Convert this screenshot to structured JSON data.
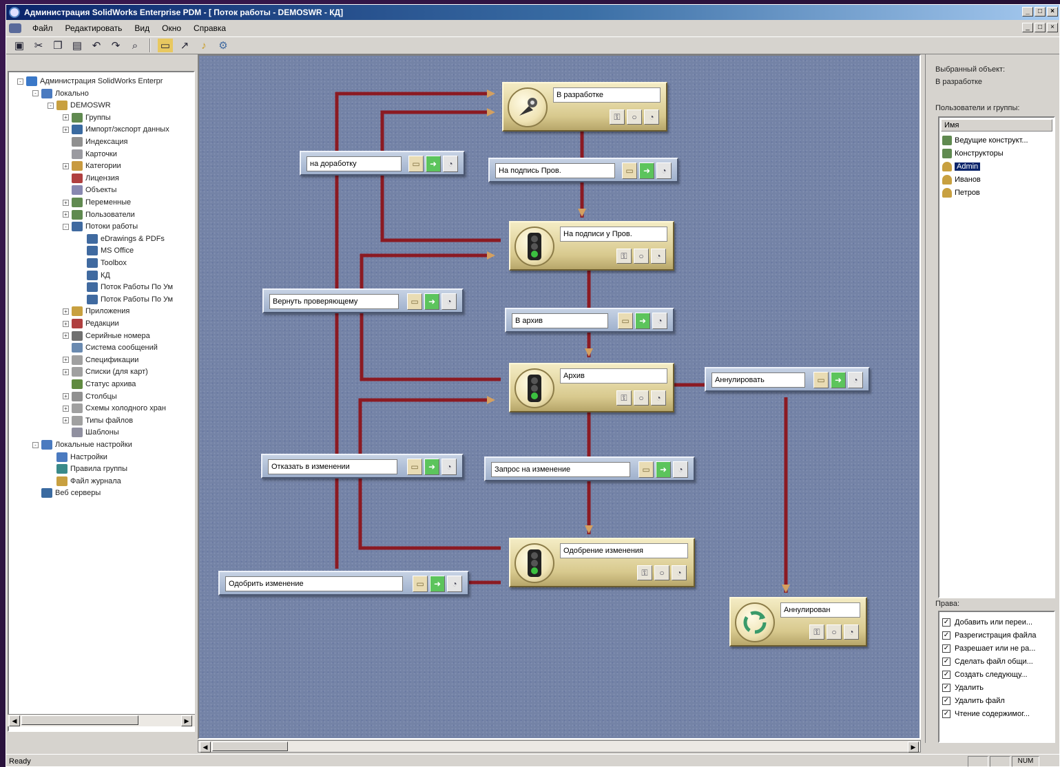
{
  "window": {
    "title": "Администрация SolidWorks Enterprise PDM - [ Поток работы - DEMOSWR - КД]",
    "controls": [
      "_",
      "□",
      "×"
    ]
  },
  "menu": [
    "Файл",
    "Редактировать",
    "Вид",
    "Окно",
    "Справка"
  ],
  "tree": {
    "items": [
      {
        "label": "Администрация SolidWorks Enterpr",
        "level": 0,
        "exp": "-",
        "icon": "pdm-admin-icon",
        "color": "#3a78c8"
      },
      {
        "label": "Локально",
        "level": 1,
        "exp": "-",
        "icon": "computer-icon",
        "color": "#4a7ac0"
      },
      {
        "label": "DEMOSWR",
        "level": 2,
        "exp": "-",
        "icon": "vault-icon",
        "color": "#c8a040"
      },
      {
        "label": "Группы",
        "level": 3,
        "exp": "+",
        "icon": "groups-icon",
        "color": "#608a50"
      },
      {
        "label": "Импорт/экспорт данных",
        "level": 3,
        "exp": "+",
        "icon": "import-export-icon",
        "color": "#3a6aa0"
      },
      {
        "label": "Индексация",
        "level": 3,
        "exp": "",
        "icon": "index-icon",
        "color": "#909090"
      },
      {
        "label": "Карточки",
        "level": 3,
        "exp": "",
        "icon": "cards-icon",
        "color": "#9a9aa0"
      },
      {
        "label": "Категории",
        "level": 3,
        "exp": "+",
        "icon": "categories-icon",
        "color": "#c89a40"
      },
      {
        "label": "Лицензия",
        "level": 3,
        "exp": "",
        "icon": "license-icon",
        "color": "#b04040"
      },
      {
        "label": "Объекты",
        "level": 3,
        "exp": "",
        "icon": "objects-icon",
        "color": "#8888b0"
      },
      {
        "label": "Переменные",
        "level": 3,
        "exp": "+",
        "icon": "variables-icon",
        "color": "#608a50"
      },
      {
        "label": "Пользователи",
        "level": 3,
        "exp": "+",
        "icon": "users-icon",
        "color": "#608a50"
      },
      {
        "label": "Потоки работы",
        "level": 3,
        "exp": "-",
        "icon": "workflows-icon",
        "color": "#406aa0"
      },
      {
        "label": "eDrawings & PDFs",
        "level": 4,
        "exp": "",
        "icon": "workflow-icon",
        "color": "#406aa0"
      },
      {
        "label": "MS Office",
        "level": 4,
        "exp": "",
        "icon": "workflow-icon",
        "color": "#406aa0"
      },
      {
        "label": "Toolbox",
        "level": 4,
        "exp": "",
        "icon": "workflow-icon",
        "color": "#406aa0"
      },
      {
        "label": "КД",
        "level": 4,
        "exp": "",
        "icon": "workflow-icon",
        "color": "#406aa0"
      },
      {
        "label": "Поток Работы По Ум",
        "level": 4,
        "exp": "",
        "icon": "workflow-icon",
        "color": "#406aa0"
      },
      {
        "label": "Поток Работы По Ум",
        "level": 4,
        "exp": "",
        "icon": "workflow-icon",
        "color": "#406aa0"
      },
      {
        "label": "Приложения",
        "level": 3,
        "exp": "+",
        "icon": "applications-icon",
        "color": "#c8a040"
      },
      {
        "label": "Редакции",
        "level": 3,
        "exp": "+",
        "icon": "revisions-icon",
        "color": "#b04040"
      },
      {
        "label": "Серийные номера",
        "level": 3,
        "exp": "+",
        "icon": "serial-numbers-icon",
        "color": "#707070"
      },
      {
        "label": "Система сообщений",
        "level": 3,
        "exp": "",
        "icon": "messages-icon",
        "color": "#6a8ab0"
      },
      {
        "label": "Спецификации",
        "level": 3,
        "exp": "+",
        "icon": "bom-icon",
        "color": "#a0a0a0"
      },
      {
        "label": "Списки (для карт)",
        "level": 3,
        "exp": "+",
        "icon": "lists-icon",
        "color": "#a0a0a0"
      },
      {
        "label": "Статус архива",
        "level": 3,
        "exp": "",
        "icon": "archive-status-icon",
        "color": "#608a40"
      },
      {
        "label": "Столбцы",
        "level": 3,
        "exp": "+",
        "icon": "columns-icon",
        "color": "#909090"
      },
      {
        "label": "Схемы холодного хран",
        "level": 3,
        "exp": "+",
        "icon": "cold-storage-icon",
        "color": "#a0a0a0"
      },
      {
        "label": "Типы файлов",
        "level": 3,
        "exp": "+",
        "icon": "file-types-icon",
        "color": "#a0a0a0"
      },
      {
        "label": "Шаблоны",
        "level": 3,
        "exp": "",
        "icon": "templates-icon",
        "color": "#9090a0"
      },
      {
        "label": "Локальные настройки",
        "level": 1,
        "exp": "-",
        "icon": "local-settings-icon",
        "color": "#4a7ac0"
      },
      {
        "label": "Настройки",
        "level": 2,
        "exp": "",
        "icon": "settings-icon",
        "color": "#4a7ac0"
      },
      {
        "label": "Правила группы",
        "level": 2,
        "exp": "",
        "icon": "group-rules-icon",
        "color": "#3a8a8a"
      },
      {
        "label": "Файл журнала",
        "level": 2,
        "exp": "",
        "icon": "log-file-icon",
        "color": "#c8a040"
      },
      {
        "label": "Веб серверы",
        "level": 1,
        "exp": "",
        "icon": "web-servers-icon",
        "color": "#3a6aa0"
      }
    ]
  },
  "workflow": {
    "states": [
      {
        "id": "s1",
        "name": "В разработке",
        "icon": "pen-nib-icon"
      },
      {
        "id": "s2",
        "name": "На подписи у Пров.",
        "icon": "traffic-light-icon"
      },
      {
        "id": "s3",
        "name": "Архив",
        "icon": "traffic-light-icon"
      },
      {
        "id": "s4",
        "name": "Одобрение изменения",
        "icon": "traffic-light-icon"
      },
      {
        "id": "s5",
        "name": "Аннулирован",
        "icon": "recycle-icon"
      }
    ],
    "transitions": [
      {
        "id": "t1",
        "name": "на доработку"
      },
      {
        "id": "t2",
        "name": "На подпись Пров."
      },
      {
        "id": "t3",
        "name": "Вернуть проверяющему"
      },
      {
        "id": "t4",
        "name": "В архив"
      },
      {
        "id": "t5",
        "name": "Аннулировать"
      },
      {
        "id": "t6",
        "name": "Отказать в изменении"
      },
      {
        "id": "t7",
        "name": "Запрос на изменение"
      },
      {
        "id": "t8",
        "name": "Одобрить изменение"
      }
    ],
    "wire_color": "#8b1a22",
    "canvas_color": "#7483a6"
  },
  "right_panel": {
    "selected_label": "Выбранный объект:",
    "selected_value": "В разработке",
    "users_label": "Пользователи и группы:",
    "users_column": "Имя",
    "users": [
      {
        "name": "Ведущие конструкт...",
        "icon": "group-icon",
        "selected": false
      },
      {
        "name": "Конструкторы",
        "icon": "group-icon",
        "selected": false
      },
      {
        "name": "Admin",
        "icon": "user-icon",
        "selected": true
      },
      {
        "name": "Иванов",
        "icon": "user-icon",
        "selected": false
      },
      {
        "name": "Петров",
        "icon": "user-icon",
        "selected": false
      }
    ],
    "perms_label": "Права:",
    "permissions": [
      {
        "label": "Добавить или переи...",
        "checked": true
      },
      {
        "label": "Разрегистрация файла",
        "checked": true
      },
      {
        "label": "Разрешает или не ра...",
        "checked": true
      },
      {
        "label": "Сделать файл общи...",
        "checked": true
      },
      {
        "label": "Создать следующу...",
        "checked": true
      },
      {
        "label": "Удалить",
        "checked": true
      },
      {
        "label": "Удалить файл",
        "checked": true
      },
      {
        "label": "Чтение содержимог...",
        "checked": true
      }
    ]
  },
  "status": {
    "text": "Ready",
    "num": "NUM"
  }
}
